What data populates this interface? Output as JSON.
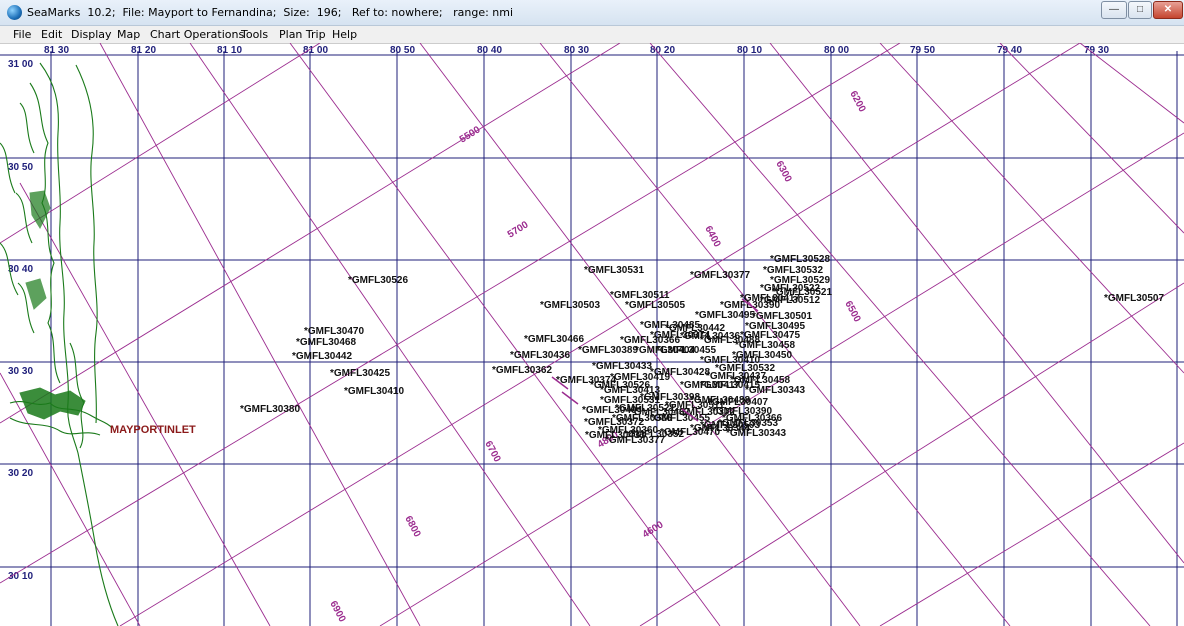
{
  "window": {
    "title": "SeaMarks  10.2;  File: Mayport to Fernandina;  Size:  196;   Ref to: nowhere;   range: nmi",
    "minimize_glyph": "—",
    "maximize_glyph": "□",
    "close_glyph": "✕",
    "app_icon": "globe-icon"
  },
  "menu": [
    "File",
    "Edit",
    "Display",
    "Map",
    "Chart Operations",
    "Tools",
    "Plan Trip",
    "Help"
  ],
  "colors": {
    "grid": "#1f1f7a",
    "loran": "#9b2c8f",
    "coast": "#1a7a1a",
    "label": "#111111",
    "landmark": "#8b1a1a"
  },
  "map": {
    "longitude_labels": [
      "81 30",
      "81 20",
      "81 10",
      "81 00",
      "80 50",
      "80 40",
      "80 30",
      "80 20",
      "80 10",
      "80 00",
      "79 50",
      "79 40",
      "79 30"
    ],
    "latitude_labels": [
      "31 00",
      "30 50",
      "30 40",
      "30 30",
      "30 20",
      "30 10"
    ],
    "loran_labels": [
      "6200",
      "6300",
      "6400",
      "6500",
      "5700",
      "5500",
      "6700",
      "6800",
      "4800",
      "4600",
      "6900"
    ],
    "landmark": "MAYPORTINLET",
    "waypoints": [
      "*GMFL30526",
      "*GMFL30470",
      "*GMFL30468",
      "*GMFL30442",
      "*GMFL30425",
      "*GMFL30410",
      "*GMFL30380",
      "*GMFL30531",
      "*GMFL30503",
      "*GMFL30466",
      "*GMFL30436",
      "*GMFL30528",
      "*GMFL30532",
      "*GMFL30529",
      "*GMFL30521",
      "*GMFL30512",
      "*GMFL30501",
      "*GMFL30495",
      "*GMFL30475",
      "*GMFL30458",
      "*GMFL30450",
      "*GMFL30437",
      "*GMFL30415",
      "*GMFL30407",
      "*GMFL30390",
      "*GMFL30353",
      "*GMFL30343",
      "*GMFL30507",
      "*GMFL30455",
      "*GMFL30419",
      "*GMFL30428",
      "*GMFL30417",
      "*GMFL30398",
      "*GMFL30366",
      "*GMFL30344",
      "*GMFL30511",
      "*GMFL30505",
      "*GMFL30485",
      "*GMFL30433",
      "*GMFL30413",
      "*GMFL30404",
      "*GMFL30386",
      "*GMFL30372",
      "*GMFL30360",
      "*GMFL30352",
      "*GMFL30377",
      "*GMFL30362",
      "*GMFL30374",
      "*GMFL30389",
      "*GMFL30488",
      "*GMFL30522"
    ]
  }
}
